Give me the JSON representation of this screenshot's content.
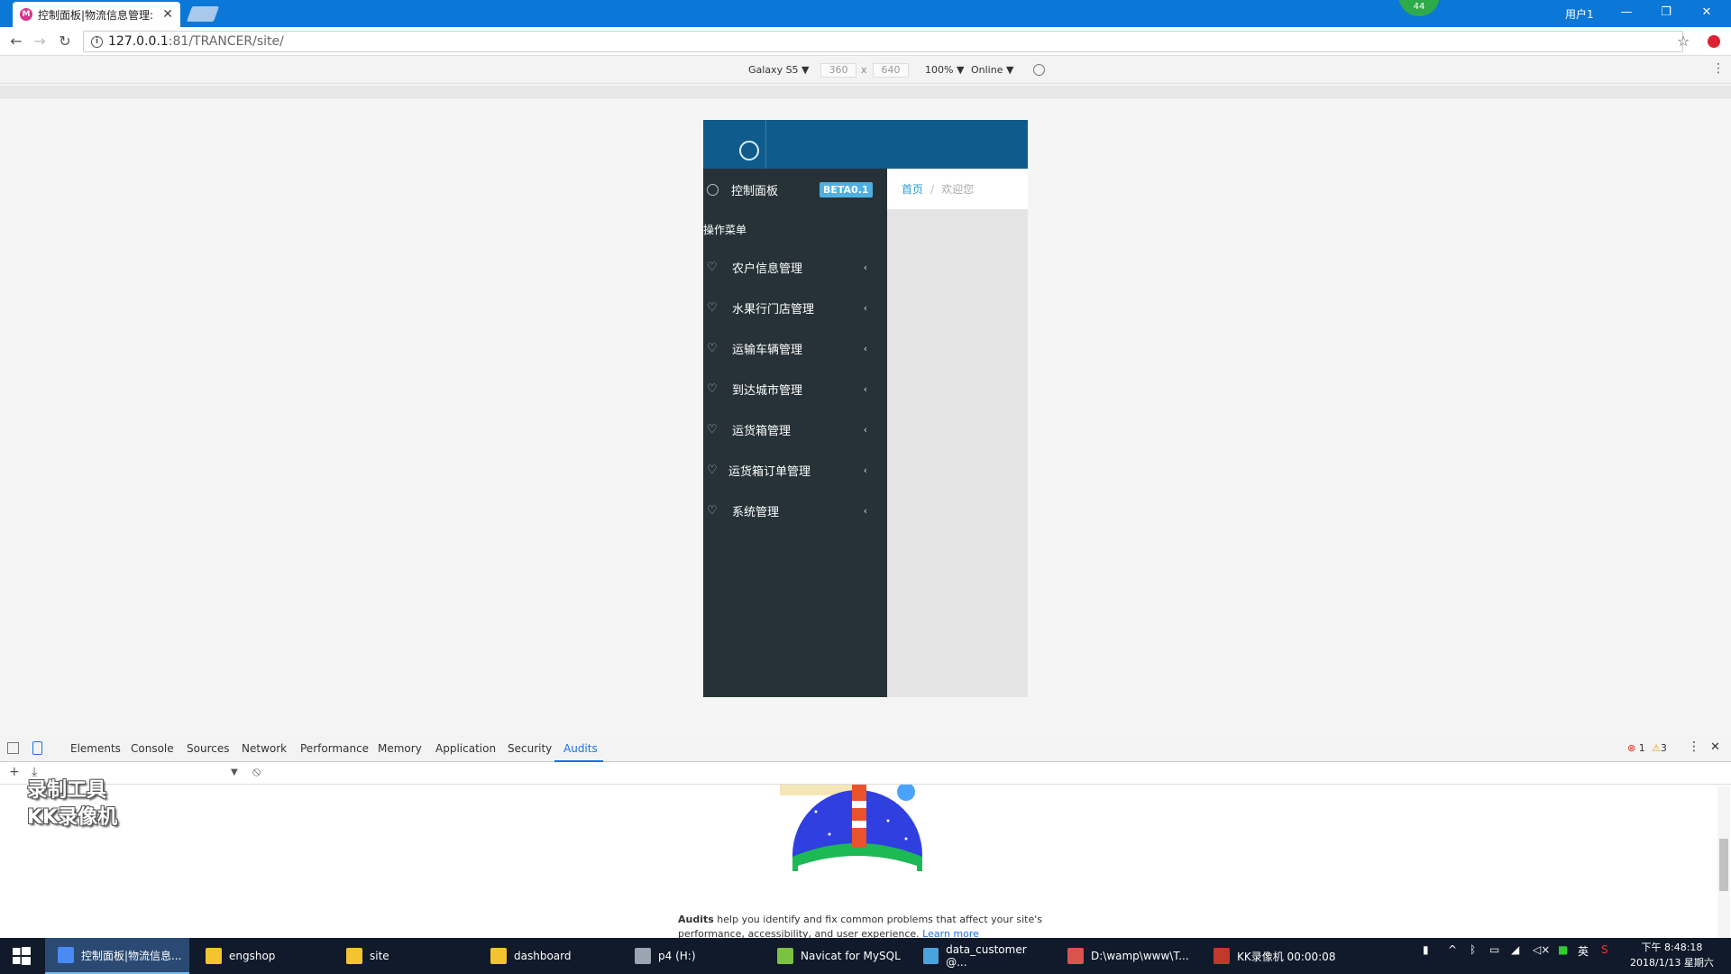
{
  "browser": {
    "tab_title": "控制面板|物流信息管理:",
    "tab_close": "✕",
    "user": "用户1",
    "badge_count": "44",
    "controls": {
      "minimize": "—",
      "restore": "❐",
      "close": "✕"
    },
    "url_host": "127.0.0.1",
    "url_rest": ":81/TRANCER/site/",
    "info_glyph": "i",
    "back_glyph": "←",
    "forward_glyph": "→",
    "reload_glyph": "↻",
    "star_glyph": "☆"
  },
  "device_toolbar": {
    "device": "Galaxy S5 ▼",
    "width": "360",
    "times": "x",
    "height": "640",
    "zoom": "100% ▼",
    "network": "Online ▼",
    "more": "⋮"
  },
  "site": {
    "brand": "控制面板",
    "beta": "BETA0.1",
    "breadcrumb_home": "首页",
    "breadcrumb_sep": "/",
    "breadcrumb_current": "欢迎您",
    "menu_heading": "操作菜单",
    "menu_icon": "♡",
    "menu_chevron": "‹",
    "menu": [
      {
        "label": "农户信息管理"
      },
      {
        "label": "水果行门店管理"
      },
      {
        "label": "运输车辆管理"
      },
      {
        "label": "到达城市管理"
      },
      {
        "label": "运货箱管理"
      },
      {
        "label": "运货箱订单管理"
      },
      {
        "label": "系统管理"
      }
    ]
  },
  "devtools": {
    "tabs": [
      "Elements",
      "Console",
      "Sources",
      "Network",
      "Performance",
      "Memory",
      "Application",
      "Security",
      "Audits"
    ],
    "active_tab": "Audits",
    "errors": "1",
    "warnings": "3",
    "error_glyph": "⊗",
    "warn_glyph": "⚠",
    "more": "⋮",
    "close": "✕",
    "add_glyph": "+",
    "download_glyph": "⤓",
    "dropdown_glyph": "▼",
    "block_glyph": "⦸",
    "audits_bold": "Audits",
    "audits_text": " help you identify and fix common problems that affect your site's performance, accessibility, and user experience. ",
    "learn_more": "Learn more"
  },
  "watermark": {
    "line1": "录制工具",
    "line2": "KK录像机"
  },
  "taskbar": {
    "items": [
      {
        "label": "控制面板|物流信息...",
        "color": "#4a8af4"
      },
      {
        "label": "engshop",
        "color": "#f4c430"
      },
      {
        "label": "site",
        "color": "#f4c430"
      },
      {
        "label": "dashboard",
        "color": "#f4c430"
      },
      {
        "label": "p4 (H:)",
        "color": "#9aa5b1"
      },
      {
        "label": "Navicat for MySQL",
        "color": "#7cc242"
      },
      {
        "label": "data_customer @...",
        "color": "#4aa3df"
      },
      {
        "label": "D:\\wamp\\www\\T...",
        "color": "#d9534f"
      },
      {
        "label": "KK录像机 00:00:08",
        "color": "#c0392b"
      }
    ],
    "tray_chevron": "^",
    "tray_ime": "英",
    "time": "下午 8:48:18",
    "date": "2018/1/13 星期六"
  }
}
